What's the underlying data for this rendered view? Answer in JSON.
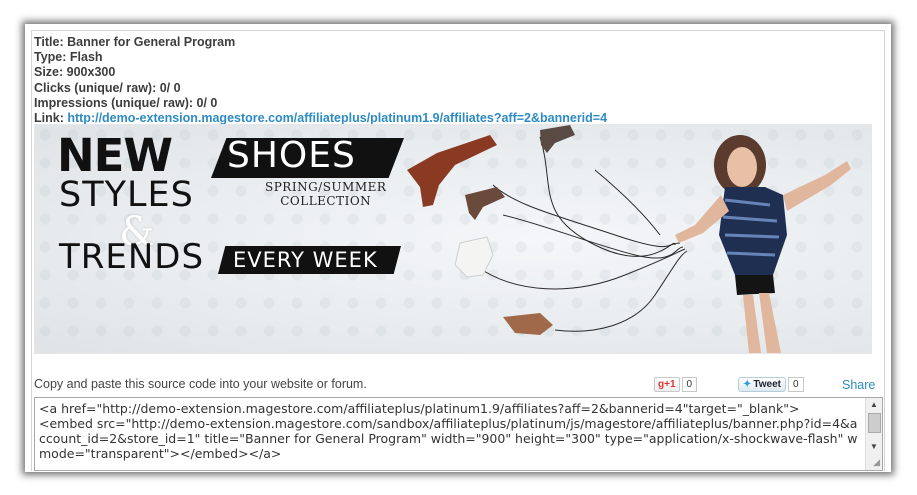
{
  "info": {
    "title": "Title: Banner for General Program",
    "type": "Type: Flash",
    "size": "Size: 900x300",
    "clicks": "Clicks (unique/ raw): 0/ 0",
    "impressions": "Impressions (unique/ raw): 0/ 0",
    "link_label": "Link: ",
    "link_url": "http://demo-extension.magestore.com/affiliateplus/platinum1.9/affiliates?aff=2&bannerid=4"
  },
  "banner": {
    "new": "NEW",
    "shoes": "SHOES",
    "spring": "SPRING/SUMMER",
    "collection": "COLLECTION",
    "styles": "STYLES",
    "amp": "&",
    "trends": "TRENDS",
    "every_week": "EVERY WEEK"
  },
  "share_bar": {
    "instruction": "Copy and paste this source code into your website or forum.",
    "gplus_label": "+1",
    "gplus_count": "0",
    "tweet_label": "Tweet",
    "tweet_count": "0",
    "share_label": "Share"
  },
  "code": {
    "source": "<a href=\"http://demo-extension.magestore.com/affiliateplus/platinum1.9/affiliates?aff=2&bannerid=4\"target=\"_blank\">\n<embed src=\"http://demo-extension.magestore.com/sandbox/affiliateplus/platinum/js/magestore/affiliateplus/banner.php?id=4&account_id=2&store_id=1\" title=\"Banner for General Program\" width=\"900\" height=\"300\" type=\"application/x-shockwave-flash\" wmode=\"transparent\"></embed></a>"
  },
  "colors": {
    "link": "#2e8bc3",
    "text": "#3d3d3d"
  }
}
